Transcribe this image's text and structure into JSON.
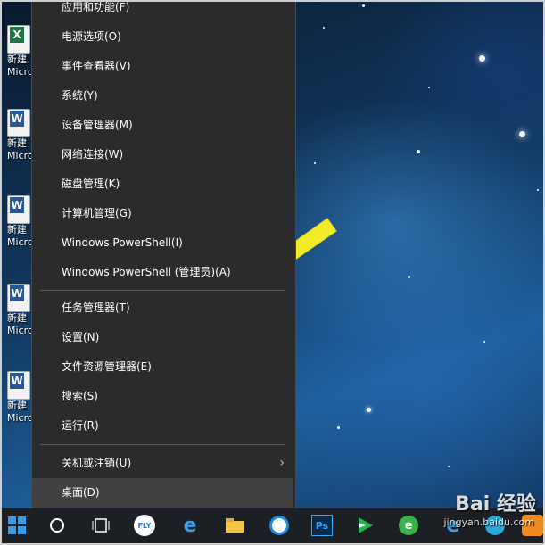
{
  "context_menu": {
    "items_top": [
      {
        "label": "应用和功能(F)"
      },
      {
        "label": "电源选项(O)"
      },
      {
        "label": "事件查看器(V)"
      },
      {
        "label": "系统(Y)"
      },
      {
        "label": "设备管理器(M)"
      },
      {
        "label": "网络连接(W)"
      },
      {
        "label": "磁盘管理(K)"
      },
      {
        "label": "计算机管理(G)"
      },
      {
        "label": "Windows PowerShell(I)"
      },
      {
        "label": "Windows PowerShell (管理员)(A)"
      }
    ],
    "items_middle": [
      {
        "label": "任务管理器(T)"
      },
      {
        "label": "设置(N)"
      },
      {
        "label": "文件资源管理器(E)"
      },
      {
        "label": "搜索(S)"
      },
      {
        "label": "运行(R)"
      }
    ],
    "items_bottom": [
      {
        "label": "关机或注销(U)"
      },
      {
        "label": "桌面(D)"
      }
    ]
  },
  "desktop_icons": [
    {
      "type": "excel",
      "label1": "新建",
      "label2": "Micro"
    },
    {
      "type": "word",
      "label1": "新建",
      "label2": "Micro"
    },
    {
      "type": "word",
      "label1": "新建",
      "label2": "Micro"
    },
    {
      "type": "word",
      "label1": "新建",
      "label2": "Micro"
    },
    {
      "type": "word",
      "label1": "新建",
      "label2": "Micro"
    }
  ],
  "taskbar": {
    "icons": [
      "windows-start-icon",
      "cortana-icon",
      "task-view-icon",
      "ifly-icon",
      "edge-icon",
      "file-explorer-icon",
      "chat-icon",
      "photoshop-icon",
      "media-player-icon",
      "browser-360-icon",
      "ie-icon",
      "app-icon",
      "orange-app-icon"
    ],
    "ps_label": "Ps",
    "ifly_label": "FLY"
  },
  "watermark": {
    "text": "Bai 经验",
    "url": "jingyan.baidu.com"
  },
  "colors": {
    "menu_bg": "#2b2b2b",
    "hover_bg": "#414141",
    "arrow": "#f3eb2a",
    "accent": "#3a9be6"
  }
}
